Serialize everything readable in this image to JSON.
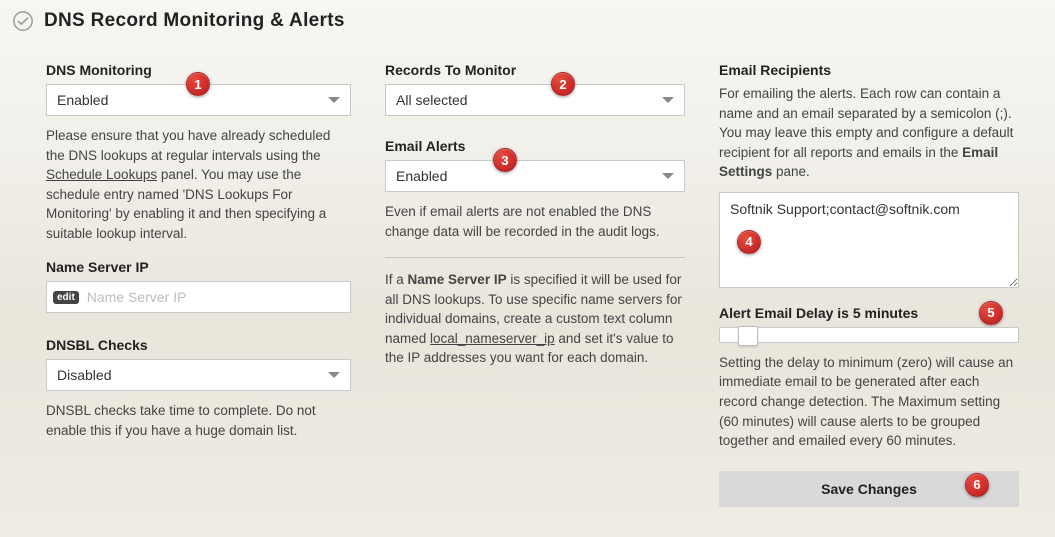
{
  "header": {
    "title": "DNS Record Monitoring & Alerts"
  },
  "col1": {
    "dns_monitoring_label": "DNS Monitoring",
    "dns_monitoring_value": "Enabled",
    "dns_monitoring_help_prefix": "Please ensure that you have already scheduled the DNS lookups at regular intervals using the ",
    "schedule_lookups_link": "Schedule Lookups",
    "dns_monitoring_help_suffix": " panel. You may use the schedule entry named 'DNS Lookups For Monitoring' by enabling it and then specifying a suitable lookup interval.",
    "name_server_ip_label": "Name Server IP",
    "edit_chip": "edit",
    "name_server_ip_placeholder": "Name Server IP",
    "name_server_ip_value": "",
    "dnsbl_label": "DNSBL Checks",
    "dnsbl_value": "Disabled",
    "dnsbl_help": "DNSBL checks take time to complete. Do not enable this if you have a huge domain list."
  },
  "col2": {
    "records_label": "Records To Monitor",
    "records_value": "All selected",
    "email_alerts_label": "Email Alerts",
    "email_alerts_value": "Enabled",
    "email_alerts_help": "Even if email alerts are not enabled the DNS change data will be recorded in the audit logs.",
    "nsip_help_p1a": "If a ",
    "nsip_help_p1b": "Name Server IP",
    "nsip_help_p1c": " is specified it will be used for all DNS lookups. To use specific name servers for individual domains, create a custom text column named ",
    "nsip_help_col": "local_nameserver_ip",
    "nsip_help_p1d": " and set it's value to the IP addresses you want for each domain."
  },
  "col3": {
    "recipients_label": "Email Recipients",
    "recipients_help_a": "For emailing the alerts. Each row can contain a name and an email separated by a semicolon (;). You may leave this empty and configure a default recipient for all reports and emails in the ",
    "recipients_help_b": "Email Settings",
    "recipients_help_c": " pane.",
    "recipients_value": "Softnik Support;contact@softnik.com",
    "delay_label": "Alert Email Delay is 5 minutes",
    "delay_value_minutes": 5,
    "delay_min": 0,
    "delay_max": 60,
    "delay_help": "Setting the delay to minimum (zero) will cause an immediate email to be generated after each record change detection. The Maximum setting (60 minutes) will cause alerts to be grouped together and emailed every 60 minutes.",
    "save_label": "Save Changes"
  },
  "callouts": [
    "1",
    "2",
    "3",
    "4",
    "5",
    "6"
  ]
}
